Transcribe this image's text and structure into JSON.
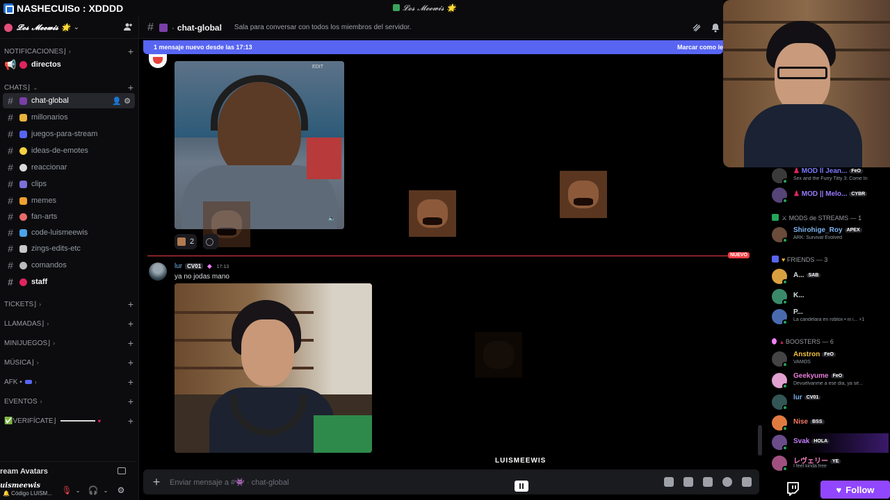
{
  "window": {
    "title": "NASHECUISo : XDDDD",
    "server_title": "𝓛𝓸𝓼 𝓜𝓮𝓮𝔀𝓲𝓼 🌟"
  },
  "server": {
    "name": "𝓛𝓸𝓼 𝓜𝓮𝓮𝔀𝓲𝓼 🌟"
  },
  "categories": [
    {
      "label": "NOTIFICACIONES⌋"
    },
    {
      "label": "CHATS⌋"
    },
    {
      "label": "TICKETS⌋"
    },
    {
      "label": "LLAMADAS⌋"
    },
    {
      "label": "MINIJUEGOS⌋"
    },
    {
      "label": "MÚSICA⌋"
    },
    {
      "label": "AFK •"
    },
    {
      "label": "EVENTOS"
    },
    {
      "label": "✅VERIFÍCATE⌋"
    }
  ],
  "channels": [
    {
      "label": "directos",
      "icon_color": "#e0245e"
    },
    {
      "label": "chat-global",
      "icon_color": "#7b3fa8"
    },
    {
      "label": "millonarios",
      "icon_color": "#e8b23a"
    },
    {
      "label": "juegos-para-stream",
      "icon_color": "#5865f2"
    },
    {
      "label": "ideas-de-emotes",
      "icon_color": "#f5d142"
    },
    {
      "label": "reaccionar",
      "icon_color": "#d9d9d9"
    },
    {
      "label": "clips",
      "icon_color": "#7b6fd8"
    },
    {
      "label": "memes",
      "icon_color": "#f0a030"
    },
    {
      "label": "fan-arts",
      "icon_color": "#e86a6a"
    },
    {
      "label": "code-luismeewis",
      "icon_color": "#4aa3e8"
    },
    {
      "label": "zings-edits-etc",
      "icon_color": "#c8c8c8"
    },
    {
      "label": "comandos",
      "icon_color": "#bbbbbb"
    },
    {
      "label": "staff",
      "icon_color": "#e0245e"
    }
  ],
  "user_area": {
    "stream_avatars": "ream Avatars",
    "username": "uismeewis",
    "status": "🔔 Código LUISM..."
  },
  "header": {
    "channel": "chat-global",
    "topic": "Sala para conversar con todos los miembros del servidor."
  },
  "new_messages": {
    "text": "1 mensaje nuevo desde las 17:13",
    "mark": "Marcar como le"
  },
  "messages": {
    "reaction_count": "2",
    "divider_label": "NUEVO",
    "video_badge": "EDIT",
    "msg2": {
      "author": "lur",
      "tag": "CV01",
      "time": "17:13",
      "text": "ya no jodas mano"
    }
  },
  "input": {
    "placeholder": "Enviar mensaje a #👾 · chat-global"
  },
  "overlay_label": "LUISMEEWIS",
  "members": {
    "top": [
      {
        "name": "MOD ll Jean...",
        "tag": "FeO",
        "activity": "Sex and the Furry Titty 3: Come In",
        "color": "#7b7bff",
        "avatar": "#3a3a3a"
      },
      {
        "name": "MOD || Melo...",
        "tag": "CYBR",
        "activity": "",
        "color": "#9b7bff",
        "avatar": "#554477"
      }
    ],
    "mods_header": "MODS de STREAMS — 1",
    "mods": [
      {
        "name": "Shirohige_Roy",
        "tag": "APEX",
        "activity": "ARK: Survival Evolved",
        "color": "#7fb4f0",
        "avatar": "#6b4c3b"
      }
    ],
    "friends_header": "FRIENDS — 3",
    "friends": [
      {
        "name": "A...",
        "tag": "SAB",
        "activity": "",
        "color": "#dbdee1",
        "avatar": "#d9a040"
      },
      {
        "name": "K...",
        "tag": "",
        "activity": "",
        "color": "#dbdee1",
        "avatar": "#3a8a6a"
      },
      {
        "name": "P...",
        "tag": "",
        "activity": "La candelara en roblox • ni i...",
        "extra": "+1",
        "color": "#dbdee1",
        "avatar": "#4a6ab0"
      }
    ],
    "boosters_header": "BOOSTERS — 6",
    "boosters": [
      {
        "name": "Anstron",
        "tag": "FeO",
        "activity": "VAMOS",
        "color": "#f0c040",
        "avatar": "#444"
      },
      {
        "name": "Geekyume",
        "tag": "FeO",
        "activity": "Devuélvanme a ese día, ya sé...",
        "color": "#e77bd8",
        "avatar": "#e0a0d0"
      },
      {
        "name": "lur",
        "tag": "CV01",
        "activity": "",
        "color": "#76b2e8",
        "avatar": "#355"
      },
      {
        "name": "Nise",
        "tag": "BSS",
        "activity": "",
        "color": "#f47b67",
        "avatar": "#e07b40"
      },
      {
        "name": "Svak",
        "tag": "HOLA",
        "activity": "",
        "color": "#c77dff",
        "avatar": "#6a4c8a"
      },
      {
        "name": "レヴェリー",
        "tag": "YE",
        "activity": "I feel kinda free",
        "color": "#f080c0",
        "avatar": "#a05080"
      }
    ]
  },
  "follow": {
    "label": "Follow"
  }
}
